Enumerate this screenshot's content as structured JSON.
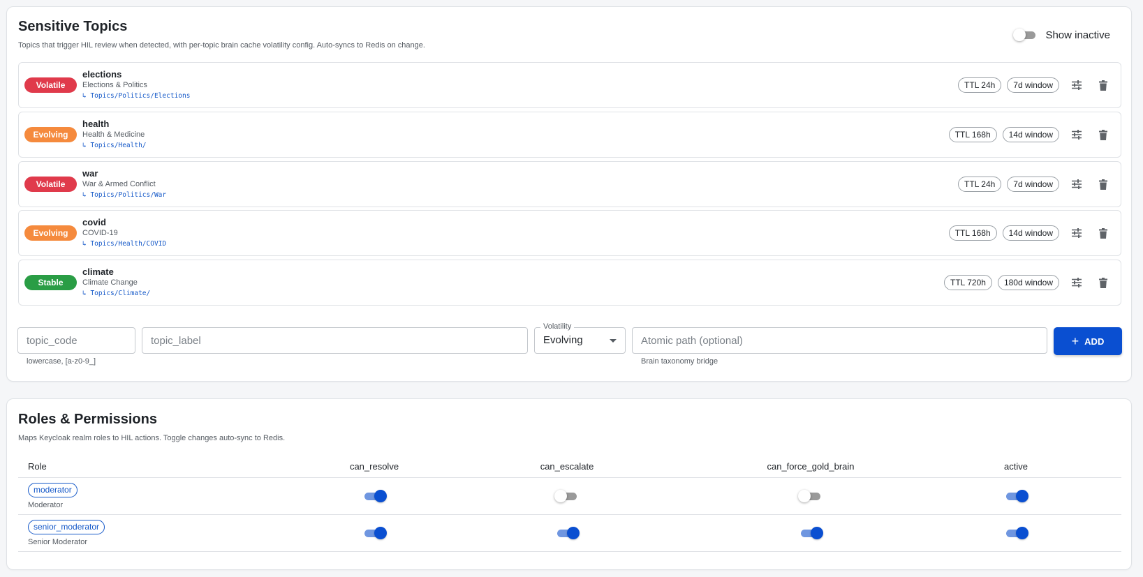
{
  "topics_section": {
    "title": "Sensitive Topics",
    "subtitle": "Topics that trigger HIL review when detected, with per-topic brain cache volatility config. Auto-syncs to Redis on change.",
    "show_inactive_label": "Show inactive",
    "show_inactive_on": false,
    "topics": [
      {
        "volatility": "Volatile",
        "color": "#e03a4b",
        "code": "elections",
        "label": "Elections & Politics",
        "path": "↳ Topics/Politics/Elections",
        "ttl": "TTL 24h",
        "window": "7d window"
      },
      {
        "volatility": "Evolving",
        "color": "#f58a3d",
        "code": "health",
        "label": "Health & Medicine",
        "path": "↳ Topics/Health/",
        "ttl": "TTL 168h",
        "window": "14d window"
      },
      {
        "volatility": "Volatile",
        "color": "#e03a4b",
        "code": "war",
        "label": "War & Armed Conflict",
        "path": "↳ Topics/Politics/War",
        "ttl": "TTL 24h",
        "window": "7d window"
      },
      {
        "volatility": "Evolving",
        "color": "#f58a3d",
        "code": "covid",
        "label": "COVID-19",
        "path": "↳ Topics/Health/COVID",
        "ttl": "TTL 168h",
        "window": "14d window"
      },
      {
        "volatility": "Stable",
        "color": "#2a9d45",
        "code": "climate",
        "label": "Climate Change",
        "path": "↳ Topics/Climate/",
        "ttl": "TTL 720h",
        "window": "180d window"
      }
    ],
    "form": {
      "code_placeholder": "topic_code",
      "code_helper": "lowercase, [a-z0-9_]",
      "label_placeholder": "topic_label",
      "volatility_legend": "Volatility",
      "volatility_value": "Evolving",
      "path_placeholder": "Atomic path (optional)",
      "path_helper": "Brain taxonomy bridge",
      "add_label": "ADD"
    }
  },
  "roles_section": {
    "title": "Roles & Permissions",
    "subtitle": "Maps Keycloak realm roles to HIL actions. Toggle changes auto-sync to Redis.",
    "columns": [
      "Role",
      "can_resolve",
      "can_escalate",
      "can_force_gold_brain",
      "active"
    ],
    "rows": [
      {
        "code": "moderator",
        "name": "Moderator",
        "can_resolve": true,
        "can_escalate": false,
        "can_force_gold_brain": false,
        "active": true
      },
      {
        "code": "senior_moderator",
        "name": "Senior Moderator",
        "can_resolve": true,
        "can_escalate": true,
        "can_force_gold_brain": true,
        "active": true
      }
    ]
  },
  "icons": {
    "tune": "tune-icon",
    "delete": "trash-icon",
    "add": "plus-icon"
  }
}
